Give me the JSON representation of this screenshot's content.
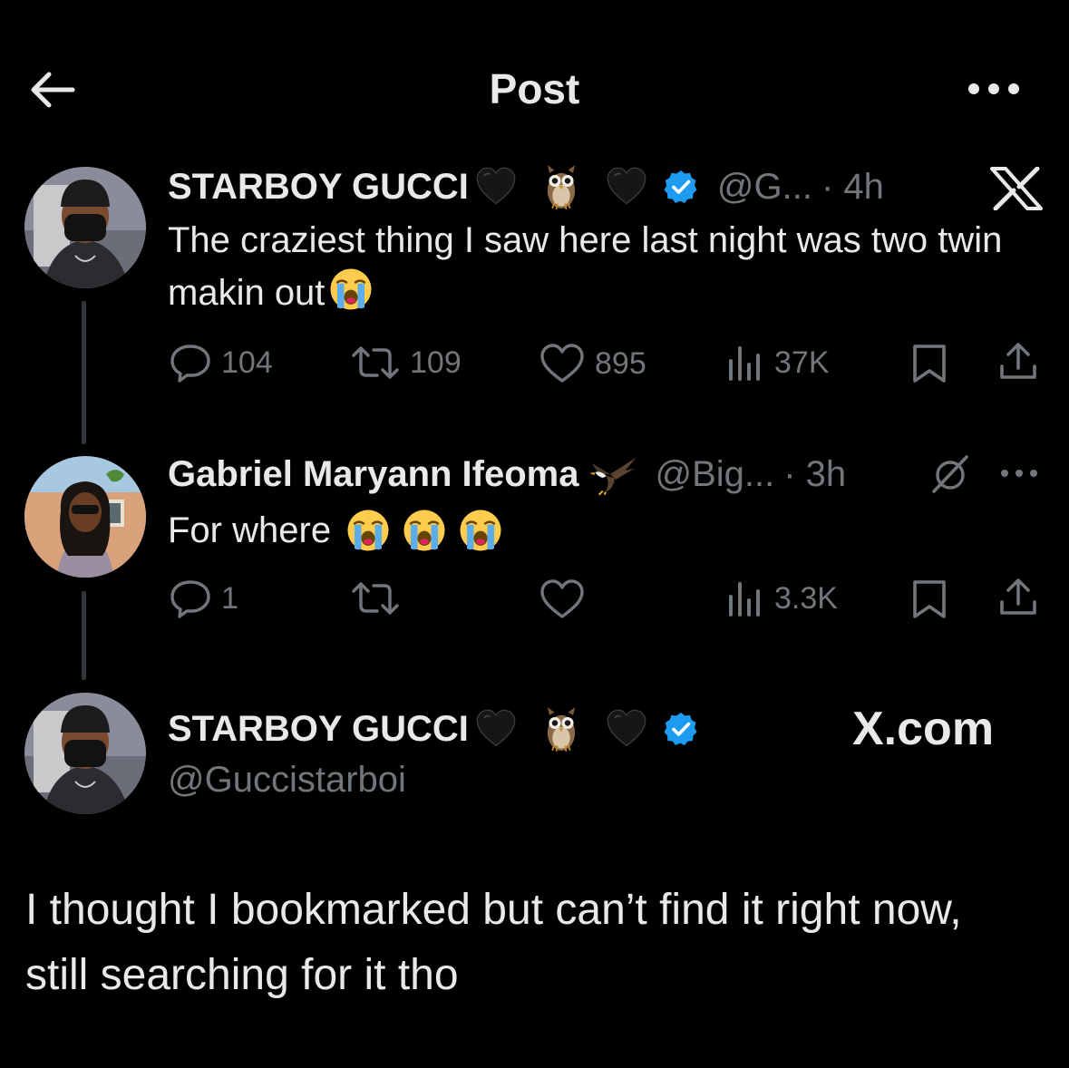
{
  "header": {
    "title": "Post"
  },
  "tweets": [
    {
      "name": "STARBOY GUCCI",
      "handle": "@G...",
      "time": "· 4h",
      "text": "The craziest thing I saw here last night was two twin makin out",
      "counts": {
        "replies": "104",
        "reposts": "109",
        "likes": "895",
        "views": "37K"
      },
      "icons": [
        "black-heart-emoji",
        "owl-emoji",
        "black-heart-emoji",
        "verified-badge",
        "x-logo"
      ]
    },
    {
      "name": "Gabriel Maryann Ifeoma",
      "handle": "@Big...",
      "time": "· 3h",
      "text": "For where",
      "counts": {
        "replies": "1",
        "reposts": "",
        "likes": "",
        "views": "3.3K"
      },
      "icons": [
        "eagle-emoji",
        "grok-icon",
        "more-icon"
      ]
    }
  ],
  "quote": {
    "name": "STARBOY GUCCI",
    "handle": "@Guccistarboi",
    "brand": "X.com",
    "text": "I thought I bookmarked but can’t find it right now, still searching for it tho"
  },
  "colors": {
    "background": "#000000",
    "text": "#e7e9ea",
    "muted": "#71767b",
    "verified": "#1d9bf0",
    "thread_line": "#333639"
  }
}
